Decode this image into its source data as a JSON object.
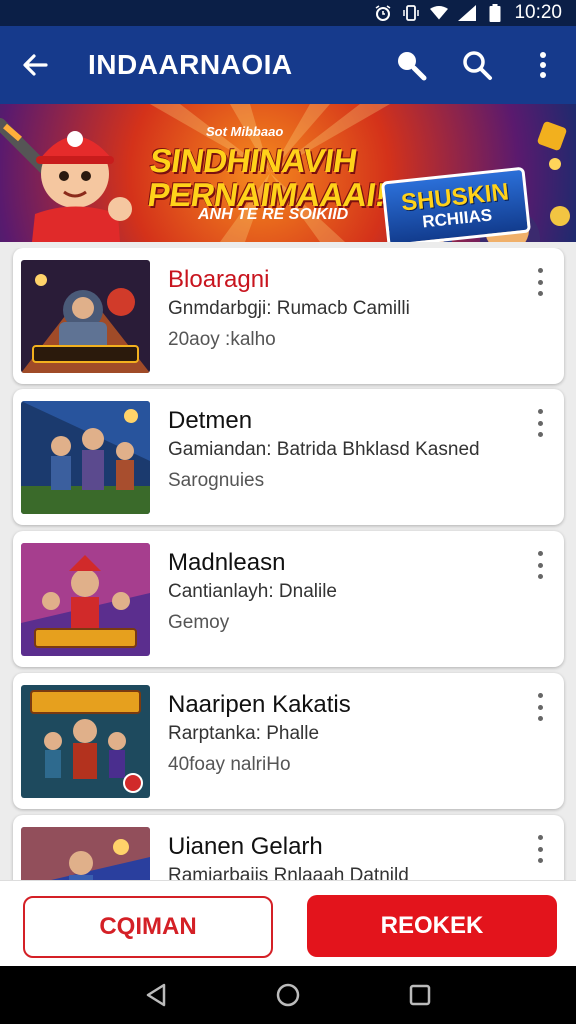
{
  "status_bar": {
    "time": "10:20",
    "icons": [
      "alarm-icon",
      "vibrate-icon",
      "wifi-icon",
      "signal-icon",
      "battery-icon"
    ]
  },
  "app_bar": {
    "title": "INDAARNAOIA",
    "icons": [
      "back-arrow-icon",
      "search-icon",
      "search-icon",
      "more-vert-icon"
    ],
    "color": "#163a8c"
  },
  "banner": {
    "pre_title": "Sot Mibbaao",
    "line1": "SINDHINAVIH",
    "line2": "PERNAIMAAAI!",
    "subline": "ANH TE RE SOIKIID",
    "badge_top": "SHUSKIN",
    "badge_bottom": "RCHIIAS"
  },
  "games": [
    {
      "title": "Bloaragni",
      "subtitle": "Gnmdarbgji: Rumacb Camilli",
      "meta": "20aoy :kalho",
      "title_color": "#c8141e"
    },
    {
      "title": "Detmen",
      "subtitle": "Gamiandan: Batrida Bhklasd Kasned",
      "meta": "Sarognuies",
      "title_color": "#111111"
    },
    {
      "title": "Madnleasn",
      "subtitle": "Cantianlayh: Dnalile",
      "meta": "Gemoy",
      "title_color": "#111111"
    },
    {
      "title": "Naaripen Kakatis",
      "subtitle": "Rarptanka: Phalle",
      "meta": "40foay nalriHo",
      "title_color": "#111111"
    },
    {
      "title": "Uianen Gelarh",
      "subtitle": "Ramiarbajis Rnlaaah Datnild",
      "meta": "",
      "title_color": "#111111"
    }
  ],
  "buttons": {
    "secondary": "CQIMAN",
    "primary": "REOKEK"
  },
  "colors": {
    "accent": "#e3141c",
    "header": "#163a8c",
    "status": "#0b1f47"
  }
}
